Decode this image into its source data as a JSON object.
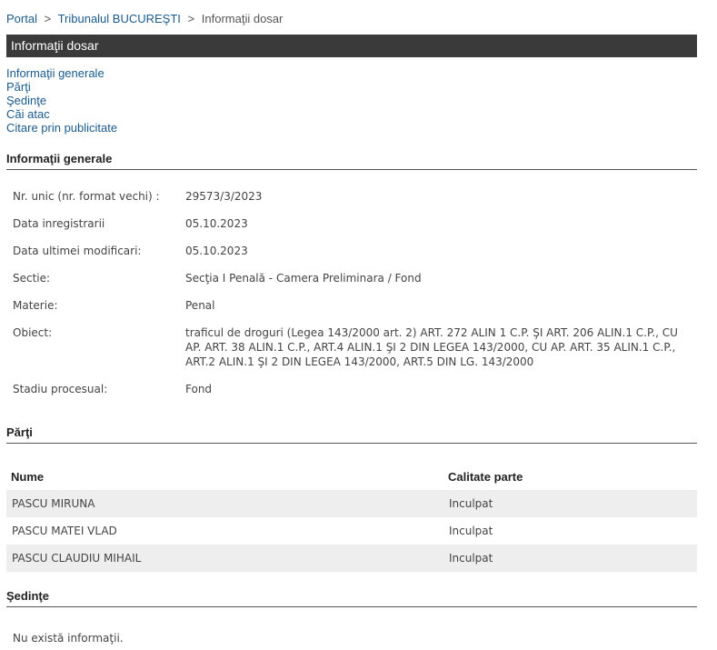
{
  "breadcrumb": {
    "items": [
      "Portal",
      "Tribunalul BUCUREŞTI",
      "Informaţii dosar"
    ],
    "separator": ">"
  },
  "title": "Informaţii dosar",
  "nav": {
    "links": [
      "Informaţii generale",
      "Părţi",
      "Şedinţe",
      "Căi atac",
      "Citare prin publicitate"
    ]
  },
  "general": {
    "heading": "Informaţii generale",
    "rows": [
      {
        "label": "Nr. unic (nr. format vechi) :",
        "value": "29573/3/2023"
      },
      {
        "label": "Data inregistrarii",
        "value": "05.10.2023"
      },
      {
        "label": "Data ultimei modificari:",
        "value": "05.10.2023"
      },
      {
        "label": "Sectie:",
        "value": "Secţia I Penală - Camera Preliminara / Fond"
      },
      {
        "label": "Materie:",
        "value": "Penal"
      },
      {
        "label": "Obiect:",
        "value": "traficul de droguri (Legea 143/2000 art. 2) ART. 272 ALIN 1 C.P. ŞI ART. 206 ALIN.1 C.P., CU AP. ART. 38 ALIN.1 C.P., ART.4 ALIN.1 ŞI 2 DIN LEGEA 143/2000, CU AP. ART. 35 ALIN.1 C.P., ART.2 ALIN.1 ŞI 2 DIN LEGEA 143/2000, ART.5 DIN LG. 143/2000"
      },
      {
        "label": "Stadiu procesual:",
        "value": "Fond"
      }
    ]
  },
  "parties": {
    "heading": "Părţi",
    "columns": [
      "Nume",
      "Calitate parte"
    ],
    "rows": [
      [
        "PASCU MIRUNA",
        "Inculpat"
      ],
      [
        "PASCU MATEI VLAD",
        "Inculpat"
      ],
      [
        "PASCU CLAUDIU MIHAIL",
        "Inculpat"
      ]
    ]
  },
  "sessions": {
    "heading": "Şedinţe",
    "empty_text": "Nu există informaţii."
  },
  "colors": {
    "link": "#1a5b8e",
    "titlebar": "#3a3a3a",
    "row_alt": "#eeeeee"
  }
}
